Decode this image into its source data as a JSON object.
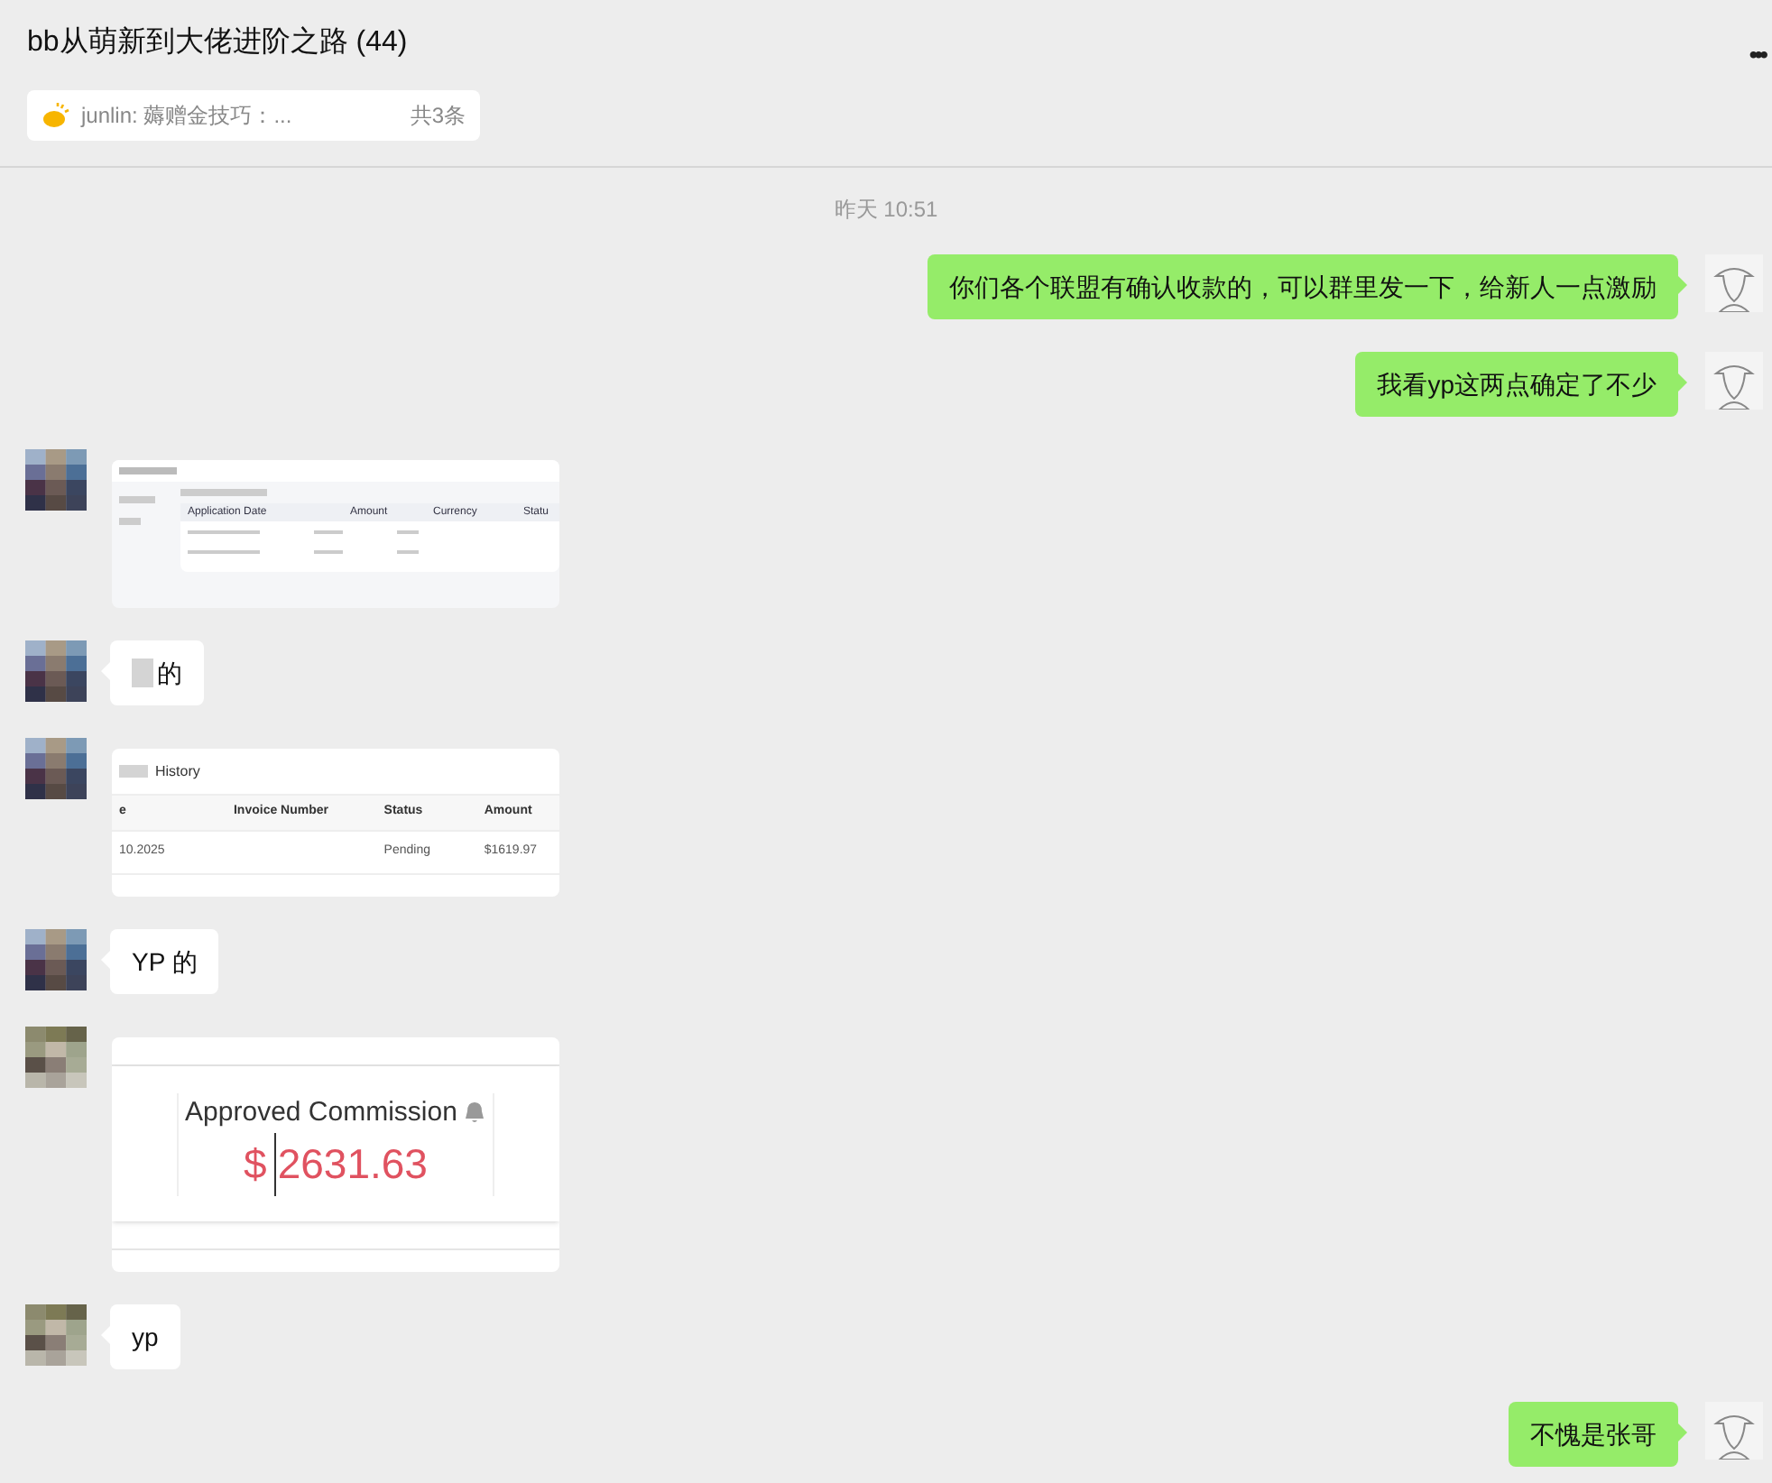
{
  "header": {
    "title": "bb从萌新到大佬进阶之路 (44)",
    "pinned": {
      "text": "junlin: 薅赠金技巧：...",
      "count": "共3条"
    },
    "more": "•••"
  },
  "timestamp": "昨天 10:51",
  "messages": [
    {
      "kind": "text",
      "outgoing": true,
      "text": "你们各个联盟有确认收款的，可以群里发一下，给新人一点激励"
    },
    {
      "kind": "text",
      "outgoing": true,
      "text": "我看yp这两点确定了不少"
    },
    {
      "outgoing": false,
      "screenshot": {
        "kind": "withdraw_table",
        "columns": [
          "Application Date",
          "Amount",
          "Currency",
          "Statu"
        ]
      }
    },
    {
      "kind": "text",
      "outgoing": false,
      "text": "的",
      "masked": true
    },
    {
      "outgoing": false,
      "screenshot": {
        "kind": "invoice_table",
        "title": "History",
        "columns": [
          "e",
          "Invoice Number",
          "Status",
          "Amount"
        ],
        "row": {
          "column_1": "10.2025",
          "status": "Pending",
          "amount": "$1619.97"
        }
      }
    },
    {
      "kind": "text",
      "outgoing": false,
      "text": "YP 的",
      "masked": false
    },
    {
      "outgoing": false,
      "screenshot": {
        "kind": "commission_card",
        "label": "Approved Commission",
        "currency": "$",
        "amount": "2631.63"
      }
    },
    {
      "kind": "text",
      "outgoing": false,
      "text": "yp",
      "masked": false
    },
    {
      "kind": "text",
      "outgoing": true,
      "text": "不愧是张哥"
    }
  ]
}
